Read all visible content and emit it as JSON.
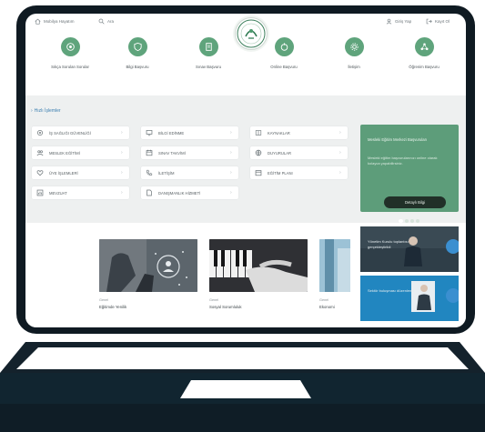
{
  "colors": {
    "accent_green": "#5fa47c",
    "promo_green": "#5d9d7a",
    "link_blue": "#3b7fb0",
    "bezel": "#0f1a22"
  },
  "topbar": {
    "left_items": [
      {
        "icon": "home-icon",
        "label": "Mobilya Hayatım"
      },
      {
        "icon": "search-icon",
        "label": "Ara"
      }
    ],
    "right_items": [
      {
        "icon": "user-icon",
        "label": "Giriş Yap"
      },
      {
        "icon": "exit-icon",
        "label": "Kayıt Ol"
      }
    ]
  },
  "mainnav": [
    {
      "icon": "target-icon",
      "label": "Sıkça Sorulan Sorular"
    },
    {
      "icon": "shield-icon",
      "label": "Bilgi Başvuru"
    },
    {
      "icon": "document-icon",
      "label": "Sınav Başvuru"
    },
    {
      "icon": "cart-icon",
      "label": "Online Başvuru"
    },
    {
      "icon": "gear-icon",
      "label": "İletişim"
    },
    {
      "icon": "network-icon",
      "label": "Öğrenim Başvuru"
    }
  ],
  "services": {
    "title": "Hızlı İşlemler",
    "cards": [
      {
        "icon": "gear-icon",
        "label": "İŞ SAĞLIĞI GÜVENLİĞİ"
      },
      {
        "icon": "monitor-icon",
        "label": "BİLGİ EDİNME"
      },
      {
        "icon": "book-icon",
        "label": "KAYNAKLAR"
      },
      {
        "icon": "people-icon",
        "label": "MESLEK EĞİTİMİ"
      },
      {
        "icon": "calendar-icon",
        "label": "SINAV TAKVİMİ"
      },
      {
        "icon": "globe-icon",
        "label": "DUYURULAR"
      },
      {
        "icon": "heart-icon",
        "label": "ÜYE İŞLEMLERİ"
      },
      {
        "icon": "phone-icon",
        "label": "İLETİŞİM"
      },
      {
        "icon": "calendar-icon",
        "label": "EĞİTİM PLANI"
      },
      {
        "icon": "chart-icon",
        "label": "MEVZUAT"
      },
      {
        "icon": "file-icon",
        "label": "DANIŞMANLIK HİZMETİ"
      }
    ]
  },
  "promo": {
    "title": "Mesleki Eğitim Merkezi Başvuruları",
    "text": "Mesleki eğitim başvurularınızı online olarak kolayca yapabilirsiniz.",
    "button": "Detaylı Bilgi"
  },
  "news": [
    {
      "category": "Genel",
      "title": "Eğitimde Yenilik"
    },
    {
      "category": "Genel",
      "title": "Sosyal Sorumluluk"
    },
    {
      "category": "Genel",
      "title": "Ekonomi"
    }
  ],
  "side_news": [
    {
      "text": "Yönetim Kurulu toplantısı gerçekleştirildi"
    },
    {
      "text": "Sektör buluşması düzenlendi"
    }
  ]
}
